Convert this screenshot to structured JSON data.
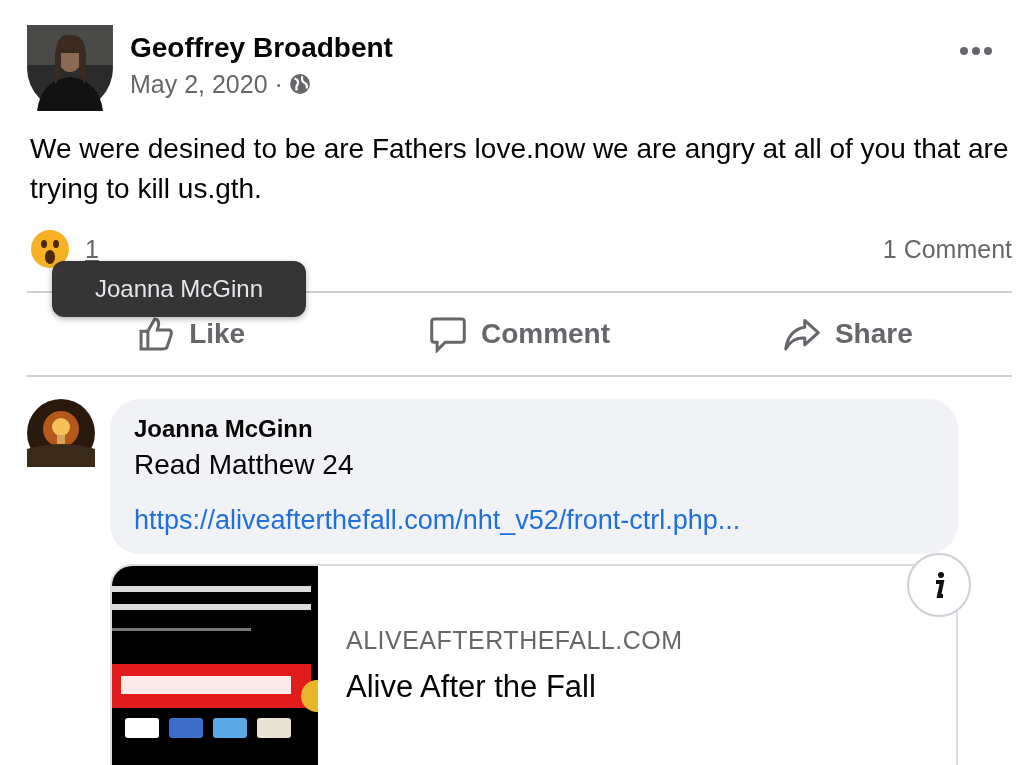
{
  "post": {
    "author": "Geoffrey Broadbent",
    "date": "May 2, 2020 ·",
    "text": "We were desined to be are Fathers love.now we are angry at all of you that are trying to kill us.gth.",
    "reaction_count": "1",
    "comment_count": "1 Comment"
  },
  "actions": [
    {
      "kind": "like",
      "label": "Like"
    },
    {
      "kind": "comment",
      "label": "Comment"
    },
    {
      "kind": "share",
      "label": "Share"
    }
  ],
  "tooltip": {
    "text": "Joanna McGinn"
  },
  "comment": {
    "author": "Joanna McGinn",
    "text": "Read Matthew 24",
    "link": "https://aliveafterthefall.com/nht_v52/front-ctrl.php...",
    "preview": {
      "kind": "picture",
      "domain": "ALIVEAFTERTHEFALL.COM",
      "title": "Alive After the Fall"
    }
  }
}
